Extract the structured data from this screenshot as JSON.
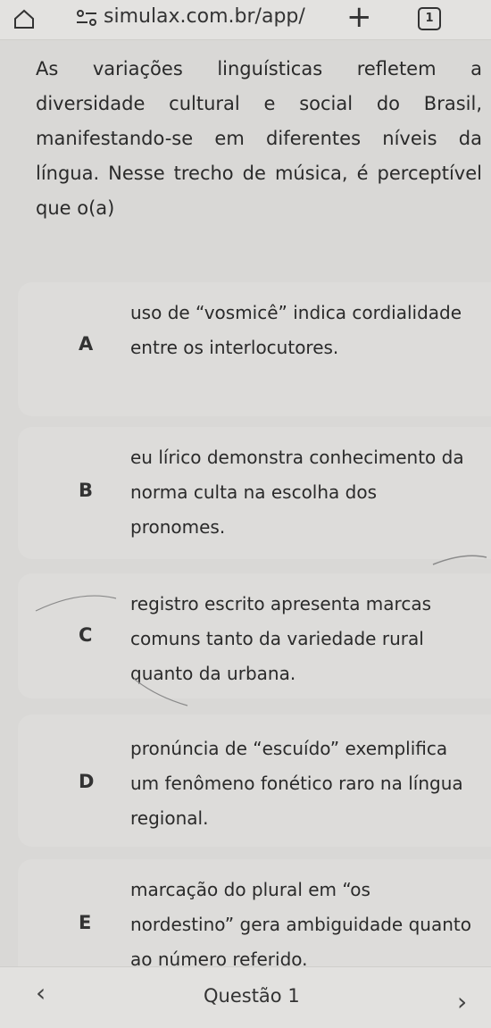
{
  "browser": {
    "url": "simulax.com.br/app/",
    "tab_count": "1",
    "icons": [
      "home-icon",
      "site-settings-icon",
      "new-tab-icon",
      "tabs-icon"
    ]
  },
  "question": {
    "text": "As variações linguísticas refletem a diversidade cultural e social do Brasil, manifestando-se em diferentes níveis da língua. Nesse trecho de música, é perceptível que o(a)"
  },
  "options": [
    {
      "letter": "A",
      "text": "uso de “vosmicê” indica cordialidade entre os interlocutores."
    },
    {
      "letter": "B",
      "text": "eu lírico demonstra conhecimento da norma culta na escolha dos pronomes."
    },
    {
      "letter": "C",
      "text": "registro escrito apresenta marcas comuns tanto da variedade rural quanto da urbana."
    },
    {
      "letter": "D",
      "text": "pronúncia de “escuído” exemplifica um fenômeno fonético raro na língua regional."
    },
    {
      "letter": "E",
      "text": "marcação do plural em “os nordestino” gera ambiguidade quanto ao número referido."
    }
  ],
  "footer": {
    "label": "Questão 1",
    "prev_icon": "chevron-left-icon",
    "next_icon": "chevron-right-icon"
  }
}
